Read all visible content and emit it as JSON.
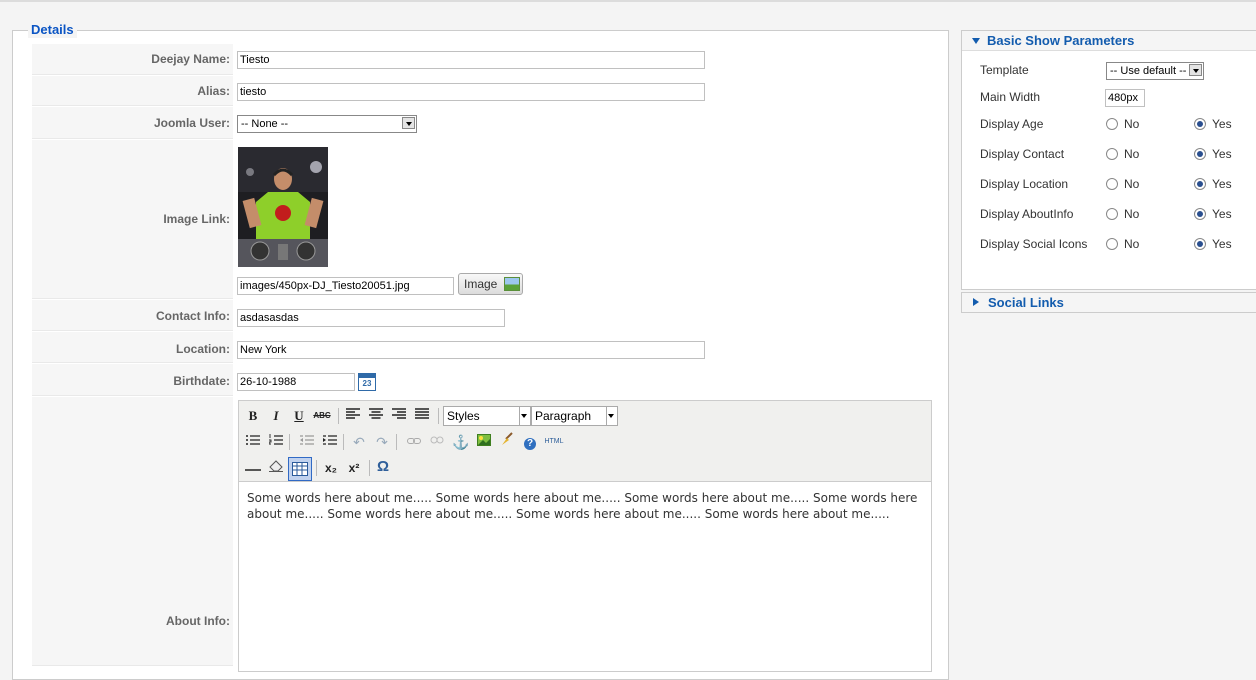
{
  "details": {
    "legend": "Details",
    "deejay_name": {
      "label": "Deejay Name:",
      "value": "Tiesto"
    },
    "alias": {
      "label": "Alias:",
      "value": "tiesto"
    },
    "joomla_user": {
      "label": "Joomla User:",
      "value": "-- None --"
    },
    "image_link": {
      "label": "Image Link:",
      "value": "images/450px-DJ_Tiesto20051.jpg",
      "button": "Image"
    },
    "contact_info": {
      "label": "Contact Info:",
      "value": "asdasasdas"
    },
    "location": {
      "label": "Location:",
      "value": "New York"
    },
    "birthdate": {
      "label": "Birthdate:",
      "value": "26-10-1988",
      "calendar_day": "23"
    },
    "about_info": {
      "label": "About Info:",
      "styles": "Styles",
      "paragraph": "Paragraph",
      "text": "Some words here about me..... Some words here about me..... Some words here about me..... Some words here about me..... Some words here about me..... Some words here about me..... Some words here about me....."
    }
  },
  "toolbar_glyphs": {
    "bold": "B",
    "italic": "I",
    "underline": "U",
    "strike": "ABC",
    "undo": "↶",
    "redo": "↷",
    "help": "?",
    "html": "HTML",
    "sub": "x₂",
    "sup": "x²",
    "omega": "Ω"
  },
  "basic_params": {
    "title": "Basic Show Parameters",
    "template": {
      "label": "Template",
      "value": "-- Use default --"
    },
    "main_width": {
      "label": "Main Width",
      "value": "480px"
    },
    "rows": [
      {
        "label": "Display Age",
        "no": "No",
        "yes": "Yes",
        "selected": "Yes"
      },
      {
        "label": "Display Contact",
        "no": "No",
        "yes": "Yes",
        "selected": "Yes"
      },
      {
        "label": "Display Location",
        "no": "No",
        "yes": "Yes",
        "selected": "Yes"
      },
      {
        "label": "Display AboutInfo",
        "no": "No",
        "yes": "Yes",
        "selected": "Yes"
      },
      {
        "label": "Display Social Icons",
        "no": "No",
        "yes": "Yes",
        "selected": "Yes"
      }
    ]
  },
  "social_links": {
    "title": "Social Links"
  },
  "colors": {
    "link_blue": "#135cae",
    "legend_blue": "#0b55c4"
  },
  "icons": [
    "calendar-icon",
    "image-icon",
    "chevron-down-icon",
    "triangle-down-icon",
    "triangle-right-icon"
  ]
}
